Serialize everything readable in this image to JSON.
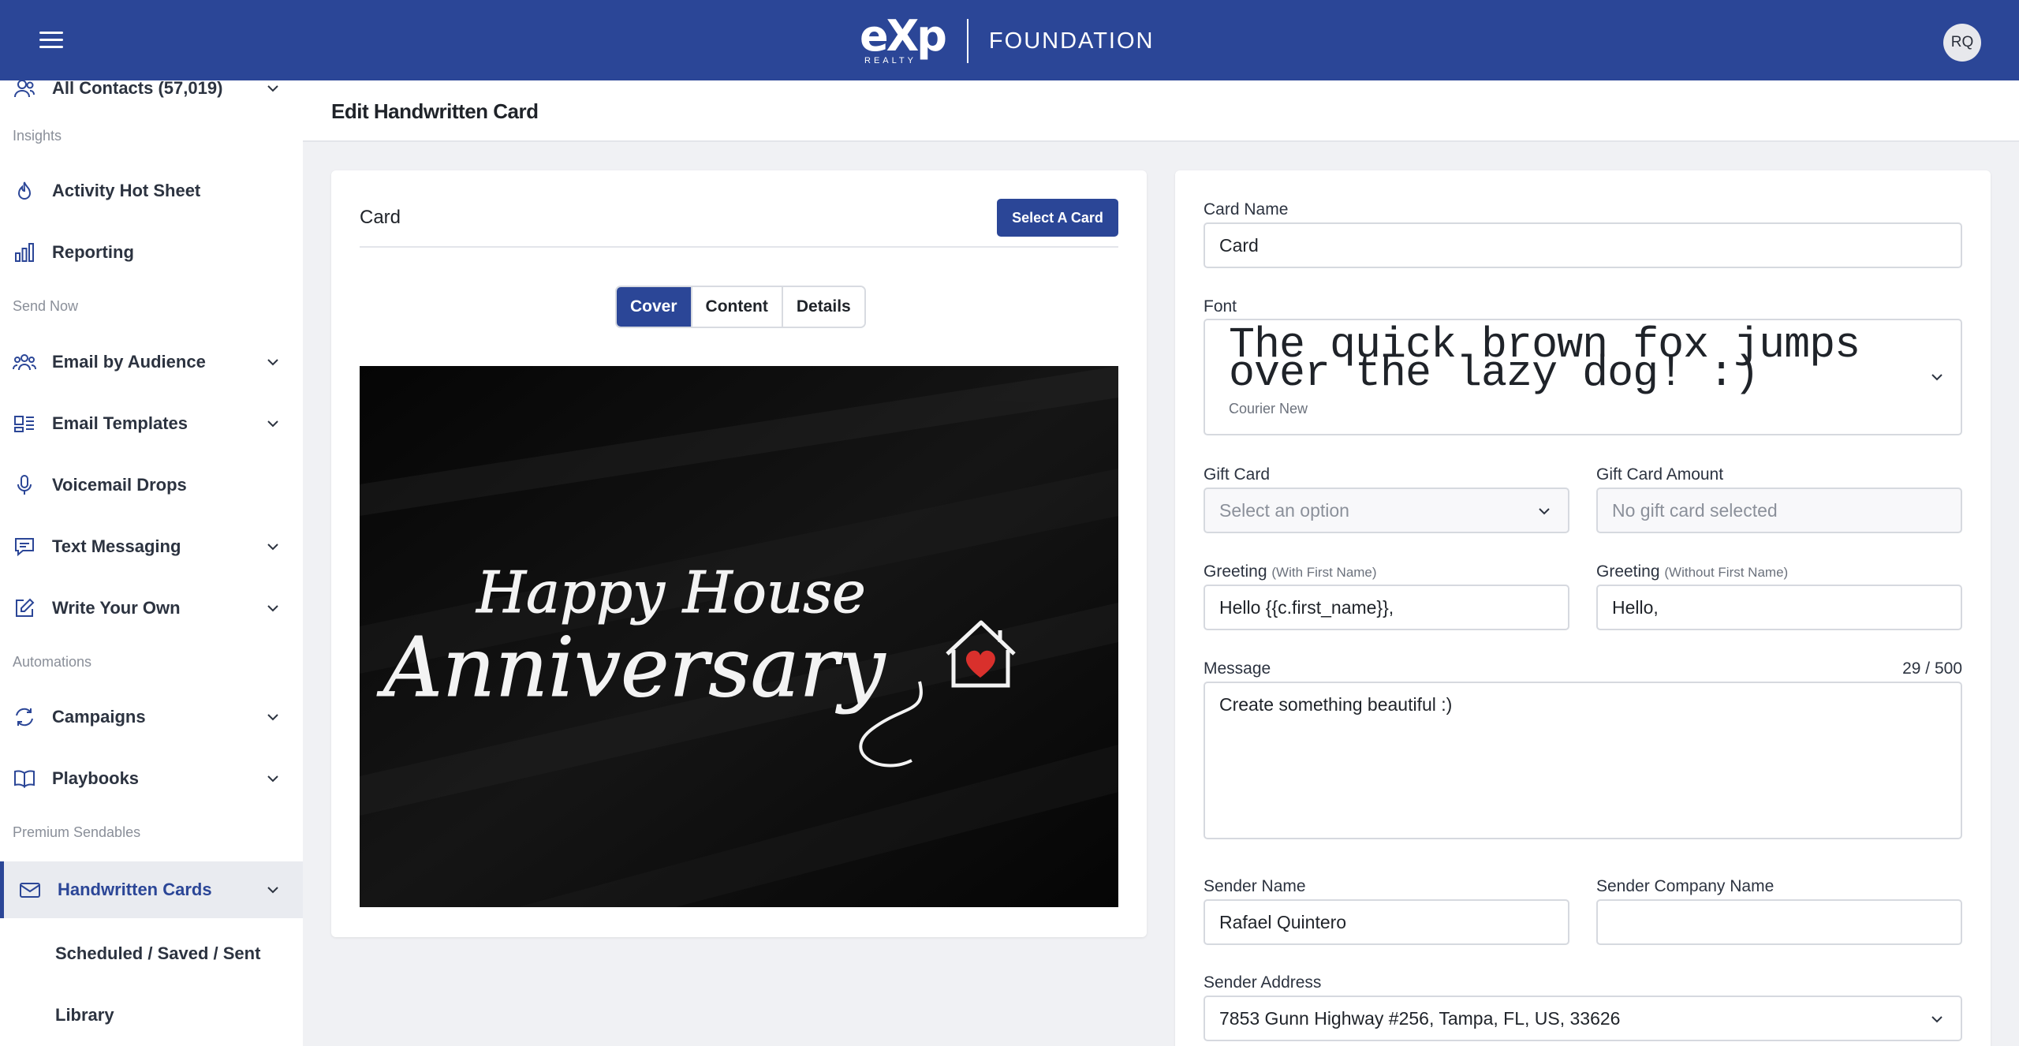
{
  "header": {
    "logo_exp": "eXp",
    "logo_realty": "REALTY",
    "logo_foundation": "FOUNDATION",
    "avatar_initials": "RQ",
    "brand_color": "#2b4697"
  },
  "sidebar": {
    "all_contacts": "All Contacts (57,019)",
    "sections": {
      "insights": "Insights",
      "send_now": "Send Now",
      "automations": "Automations",
      "premium": "Premium Sendables"
    },
    "items": {
      "activity": "Activity Hot Sheet",
      "reporting": "Reporting",
      "email_audience": "Email by Audience",
      "email_templates": "Email Templates",
      "voicemail": "Voicemail Drops",
      "text_messaging": "Text Messaging",
      "write_own": "Write Your Own",
      "campaigns": "Campaigns",
      "playbooks": "Playbooks",
      "handwritten": "Handwritten Cards"
    },
    "sub_items": {
      "scheduled": "Scheduled / Saved / Sent",
      "library": "Library"
    }
  },
  "page": {
    "title": "Edit Handwritten Card"
  },
  "card_panel": {
    "label": "Card",
    "select_button": "Select A Card",
    "tabs": [
      "Cover",
      "Content",
      "Details"
    ],
    "active_tab": "Cover",
    "cover_text_line1": "Happy House",
    "cover_text_line2": "Anniversary"
  },
  "form": {
    "card_name_label": "Card Name",
    "card_name_value": "Card",
    "font_label": "Font",
    "font_sample": "The quick brown fox jumps over the lazy dog! :)",
    "font_name": "Courier New",
    "gift_card_label": "Gift Card",
    "gift_card_placeholder": "Select an option",
    "gift_amount_label": "Gift Card Amount",
    "gift_amount_placeholder": "No gift card selected",
    "greeting_label": "Greeting",
    "greeting_first_hint": "(With First Name)",
    "greeting_first_value": "Hello {{c.first_name}},",
    "greeting_nofirst_hint": "(Without First Name)",
    "greeting_nofirst_value": "Hello,",
    "message_label": "Message",
    "message_counter": "29 / 500",
    "message_value": "Create something beautiful :)",
    "sender_name_label": "Sender Name",
    "sender_name_value": "Rafael Quintero",
    "sender_company_label": "Sender Company Name",
    "sender_company_value": "",
    "sender_address_label": "Sender Address",
    "sender_address_value": "7853 Gunn Highway #256, Tampa, FL, US, 33626"
  }
}
